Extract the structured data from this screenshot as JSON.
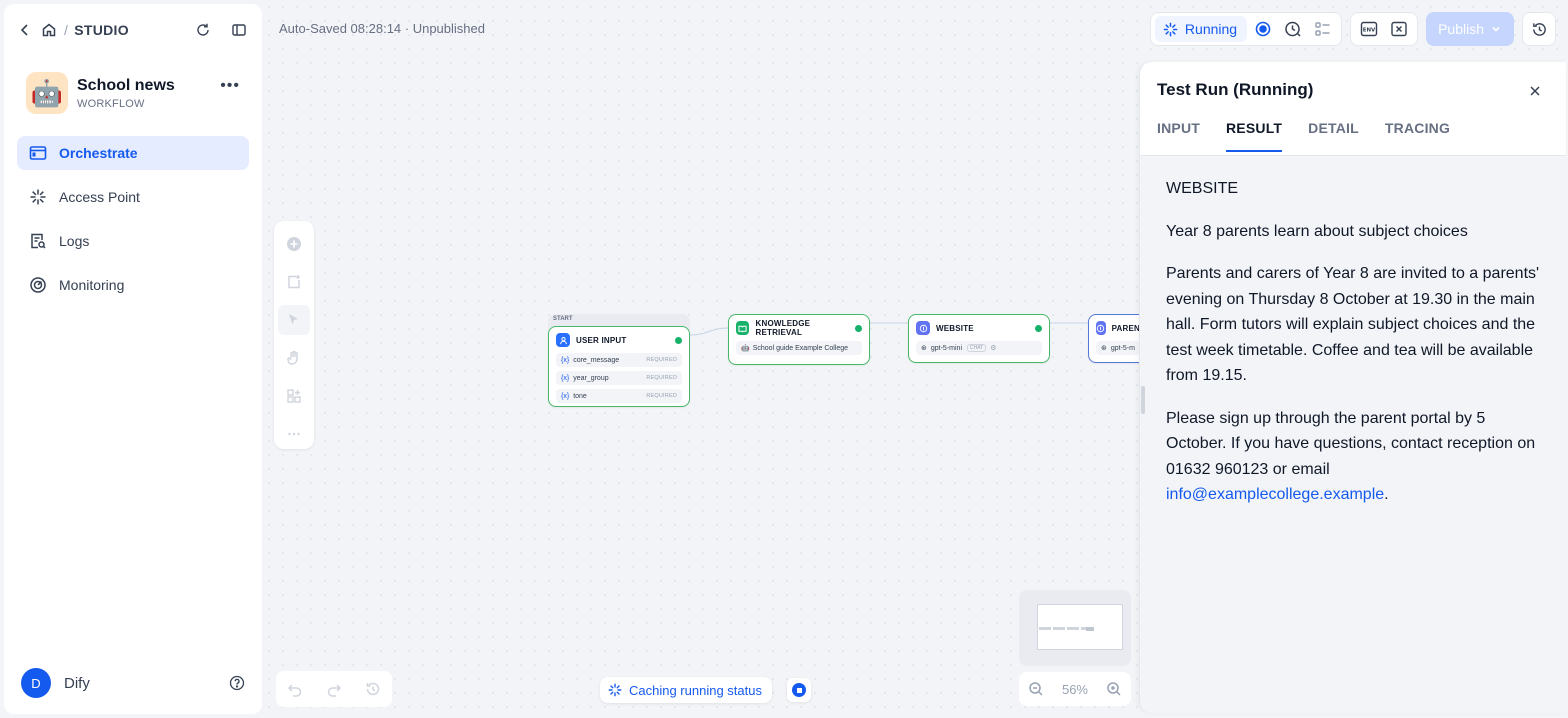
{
  "breadcrumb": {
    "root": "STUDIO"
  },
  "app": {
    "name": "School news",
    "type": "WORKFLOW",
    "emoji": "🤖"
  },
  "nav": [
    {
      "label": "Orchestrate",
      "active": true
    },
    {
      "label": "Access Point"
    },
    {
      "label": "Logs"
    },
    {
      "label": "Monitoring"
    }
  ],
  "user": {
    "initial": "D",
    "name": "Dify"
  },
  "status": {
    "autosave": "Auto-Saved 08:28:14 · Unpublished"
  },
  "toolbar": {
    "running_label": "Running",
    "publish_label": "Publish"
  },
  "nodes": {
    "start_tag": "START",
    "user_input": {
      "title": "USER INPUT",
      "vars": [
        {
          "name": "core_message",
          "tag": "REQUIRED"
        },
        {
          "name": "year_group",
          "tag": "REQUIRED"
        },
        {
          "name": "tone",
          "tag": "REQUIRED"
        }
      ]
    },
    "knowledge": {
      "title": "KNOWLEDGE RETRIEVAL",
      "dataset": "School guide Example College"
    },
    "website": {
      "title": "WEBSITE",
      "model": "gpt-5-mini",
      "mode": "CHAT"
    },
    "parent": {
      "title": "PAREN",
      "model": "gpt-5-m"
    }
  },
  "zoom": {
    "level": "56%"
  },
  "caching": {
    "label": "Caching running status"
  },
  "panel": {
    "title": "Test Run (Running)",
    "tabs": [
      "INPUT",
      "RESULT",
      "DETAIL",
      "TRACING"
    ],
    "active_tab": "RESULT",
    "result": {
      "heading": "WEBSITE",
      "headline": "Year 8 parents learn about subject choices",
      "para1": "Parents and carers of Year 8 are invited to a parents' evening on Thursday 8 October at 19.30 in the main hall. Form tutors will explain subject choices and the test week timetable. Coffee and tea will be available from 19.15.",
      "para2_text": "Please sign up through the parent portal by 5 October. If you have questions, contact reception on 01632 960123 or email ",
      "email": "info@examplecollege.example",
      "para2_end": "."
    }
  },
  "colors": {
    "accent": "#155aef",
    "success": "#17b26a",
    "node_border": "#47b768"
  }
}
